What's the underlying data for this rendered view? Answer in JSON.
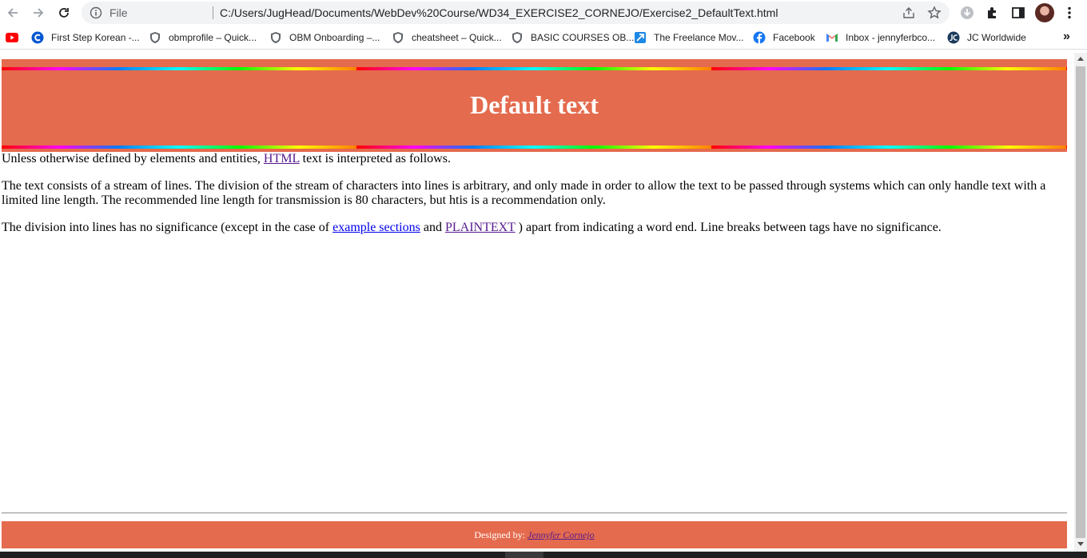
{
  "browser": {
    "omnibox": {
      "scheme_label": "File",
      "url": "C:/Users/JugHead/Documents/WebDev%20Course/WD34_EXERCISE2_CORNEJO/Exercise2_DefaultText.html"
    },
    "bookmarks": [
      {
        "label": "",
        "icon": "youtube-icon"
      },
      {
        "label": "First Step Korean -...",
        "icon": "coursera-icon"
      },
      {
        "label": "obmprofile – Quick...",
        "icon": "shield-icon"
      },
      {
        "label": "OBM Onboarding –...",
        "icon": "shield-icon"
      },
      {
        "label": "cheatsheet – Quick...",
        "icon": "shield-icon"
      },
      {
        "label": "BASIC COURSES OB...",
        "icon": "shield-icon"
      },
      {
        "label": "The Freelance Mov...",
        "icon": "freelance-icon"
      },
      {
        "label": "Facebook",
        "icon": "facebook-icon"
      },
      {
        "label": "Inbox - jennyferbco...",
        "icon": "gmail-icon"
      },
      {
        "label": "JC Worldwide",
        "icon": "jc-icon"
      }
    ],
    "bookmarks_overflow": "»"
  },
  "page": {
    "title": "Default text",
    "intro": {
      "before": "Unless otherwise defined by elements and entities, ",
      "link": "HTML",
      "after": " text is interpreted as follows."
    },
    "para2": "The text consists of a stream of lines. The division of the stream of characters into lines is arbitrary, and only made in order to allow the text to be passed through systems which can only handle text with a limited line length. The recommended line length for transmission is 80 characters, but htis is a recommendation only.",
    "para3": {
      "before": "The division into lines has no significance (except in the case of ",
      "link1": "example sections",
      "middle": " and ",
      "link2": "PLAINTEXT",
      "after": " ) apart from indicating a word end. Line breaks between tags have no significance."
    },
    "footer": {
      "prefix": "Designed by: ",
      "author": "Jennyfer Cornejo"
    }
  },
  "colors": {
    "header_bg": "#e46b4e",
    "link": "#0000ee",
    "visited_link": "#551a8b"
  }
}
